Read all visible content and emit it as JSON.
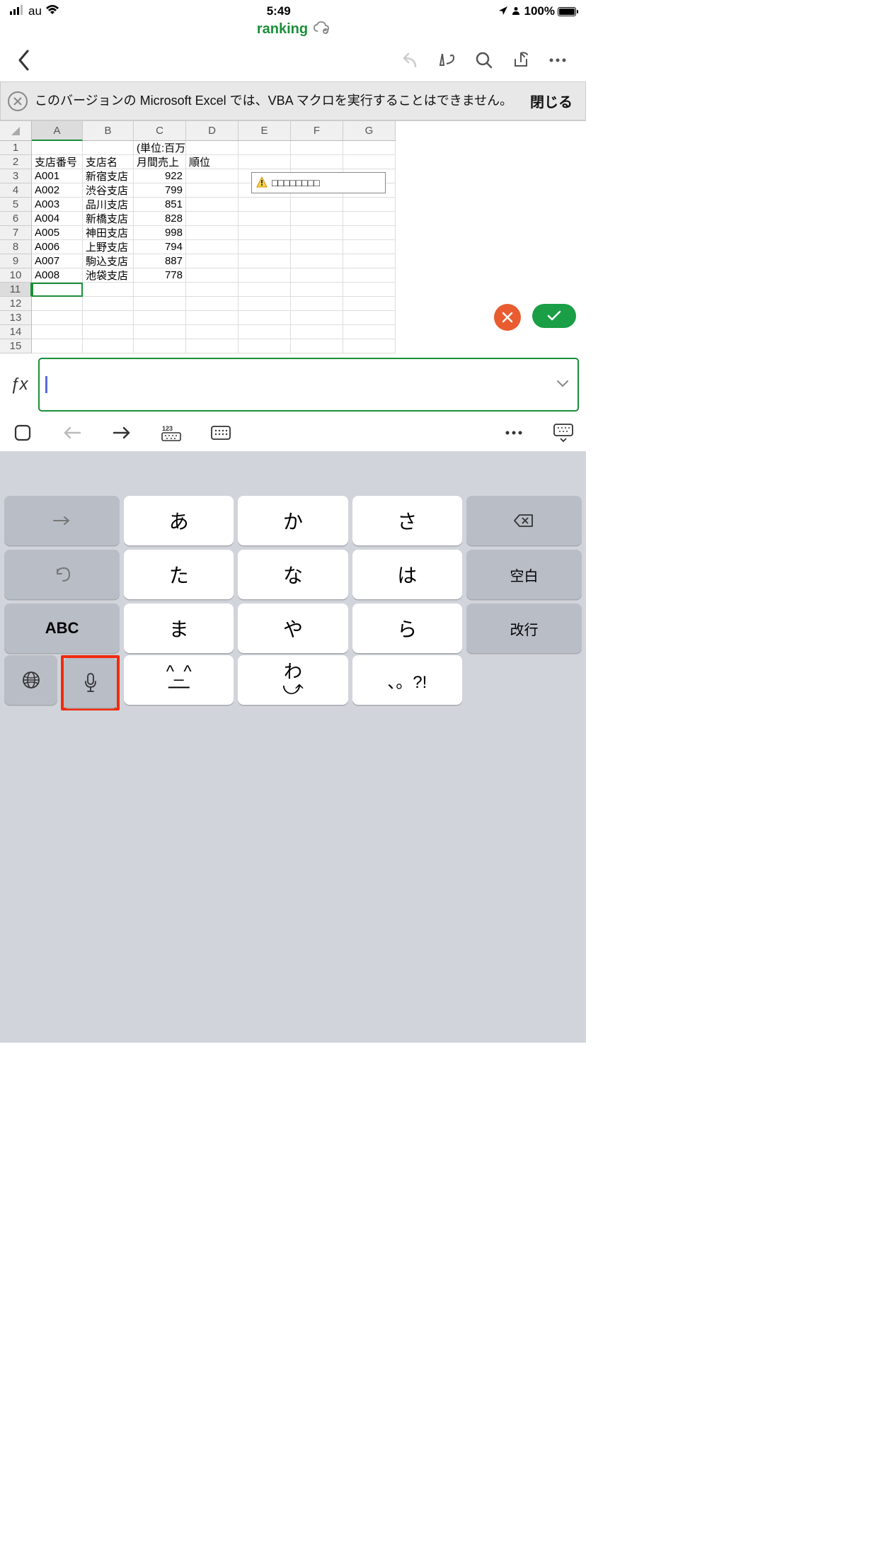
{
  "status": {
    "carrier": "au",
    "time": "5:49",
    "battery": "100%"
  },
  "document": {
    "title": "ranking"
  },
  "banner": {
    "message": "このバージョンの Microsoft Excel では、VBA マクロを実行することはできません。",
    "close": "閉じる"
  },
  "columns": [
    "A",
    "B",
    "C",
    "D",
    "E",
    "F",
    "G"
  ],
  "selectedCol": "A",
  "selectedRow": 11,
  "rows": [
    {
      "n": 1,
      "cells": [
        "",
        "",
        "(単位:百万円)",
        "",
        "",
        "",
        ""
      ]
    },
    {
      "n": 2,
      "cells": [
        "支店番号",
        "支店名",
        "月間売上",
        "順位",
        "",
        "",
        ""
      ]
    },
    {
      "n": 3,
      "cells": [
        "A001",
        "新宿支店",
        "922",
        "",
        "",
        "",
        ""
      ]
    },
    {
      "n": 4,
      "cells": [
        "A002",
        "渋谷支店",
        "799",
        "",
        "",
        "",
        ""
      ]
    },
    {
      "n": 5,
      "cells": [
        "A003",
        "品川支店",
        "851",
        "",
        "",
        "",
        ""
      ]
    },
    {
      "n": 6,
      "cells": [
        "A004",
        "新橋支店",
        "828",
        "",
        "",
        "",
        ""
      ]
    },
    {
      "n": 7,
      "cells": [
        "A005",
        "神田支店",
        "998",
        "",
        "",
        "",
        ""
      ]
    },
    {
      "n": 8,
      "cells": [
        "A006",
        "上野支店",
        "794",
        "",
        "",
        "",
        ""
      ]
    },
    {
      "n": 9,
      "cells": [
        "A007",
        "駒込支店",
        "887",
        "",
        "",
        "",
        ""
      ]
    },
    {
      "n": 10,
      "cells": [
        "A008",
        "池袋支店",
        "778",
        "",
        "",
        "",
        ""
      ]
    },
    {
      "n": 11,
      "cells": [
        "",
        "",
        "",
        "",
        "",
        "",
        ""
      ]
    },
    {
      "n": 12,
      "cells": [
        "",
        "",
        "",
        "",
        "",
        "",
        ""
      ]
    },
    {
      "n": 13,
      "cells": [
        "",
        "",
        "",
        "",
        "",
        "",
        ""
      ]
    },
    {
      "n": 14,
      "cells": [
        "",
        "",
        "",
        "",
        "",
        "",
        ""
      ]
    },
    {
      "n": 15,
      "cells": [
        "",
        "",
        "",
        "",
        "",
        "",
        ""
      ]
    }
  ],
  "popup": "□□□□□□□□",
  "formula": {
    "value": ""
  },
  "keyboard": {
    "rows": [
      [
        "→",
        "あ",
        "か",
        "さ",
        "⌫"
      ],
      [
        "↺",
        "た",
        "な",
        "は",
        "空白"
      ],
      [
        "ABC",
        "ま",
        "や",
        "ら",
        "改行"
      ],
      [
        "🌐",
        "🎤",
        "^_^",
        "わ",
        "、。?!",
        ""
      ]
    ]
  }
}
